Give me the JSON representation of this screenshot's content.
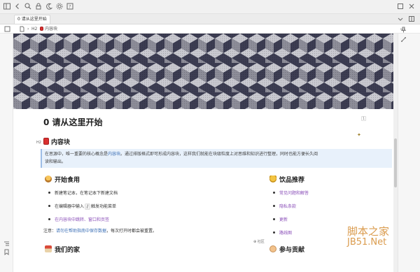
{
  "tab": {
    "label": "0 请从这里开始"
  },
  "breadcrumb": {
    "heading_badge": "H2",
    "page": "内容块"
  },
  "document": {
    "title": "0 请从这里开始",
    "block_count": "1",
    "heading_badge": "H2",
    "section_title": "内容块",
    "callout_text_a": "在思源中，唯一重要的核心概念是",
    "callout_link": "内容块",
    "callout_text_b": "。通过排版格式即可形成内容块，这样我们就能在块级粒度上对思维和知识进行整理，同时也能方便长久阅",
    "callout_text_c": "读和输出。",
    "getting_started": {
      "title": "开始食用",
      "items": [
        {
          "text": "新建笔记本，在笔记本下新建文档"
        },
        {
          "prefix": "在编辑器中输入",
          "code": "/",
          "suffix": "触发功能菜单"
        },
        {
          "text": "在内容块中跳转、窗口和页签"
        }
      ]
    },
    "drinks": {
      "title": "饮品推荐",
      "items": [
        "常见问题和解答",
        "隐私条款",
        "更新",
        "路线图"
      ]
    },
    "note_label": "注意：",
    "note_blue": "请勿在帮助指南中保存数据",
    "note_rest": "，每次打开时都会被重置。",
    "community": "社区",
    "home_title": "我们的家",
    "contribute_title": "参与贡献"
  },
  "watermark": {
    "line1": "脚本之家",
    "line2": "JB51.Net"
  },
  "colors": {
    "accent": "#3b6fb6",
    "callout_bg": "#e8f1fb",
    "link_purple": "#8a4fb8",
    "banner_dark": "#3c3d52",
    "banner_light": "#8d8d99"
  },
  "icons": [
    "menu-icon",
    "back-icon",
    "forward-icon",
    "search-icon",
    "lock-icon",
    "moon-icon",
    "settings-icon",
    "help-icon",
    "close-icon",
    "pin-icon",
    "file-icon"
  ]
}
